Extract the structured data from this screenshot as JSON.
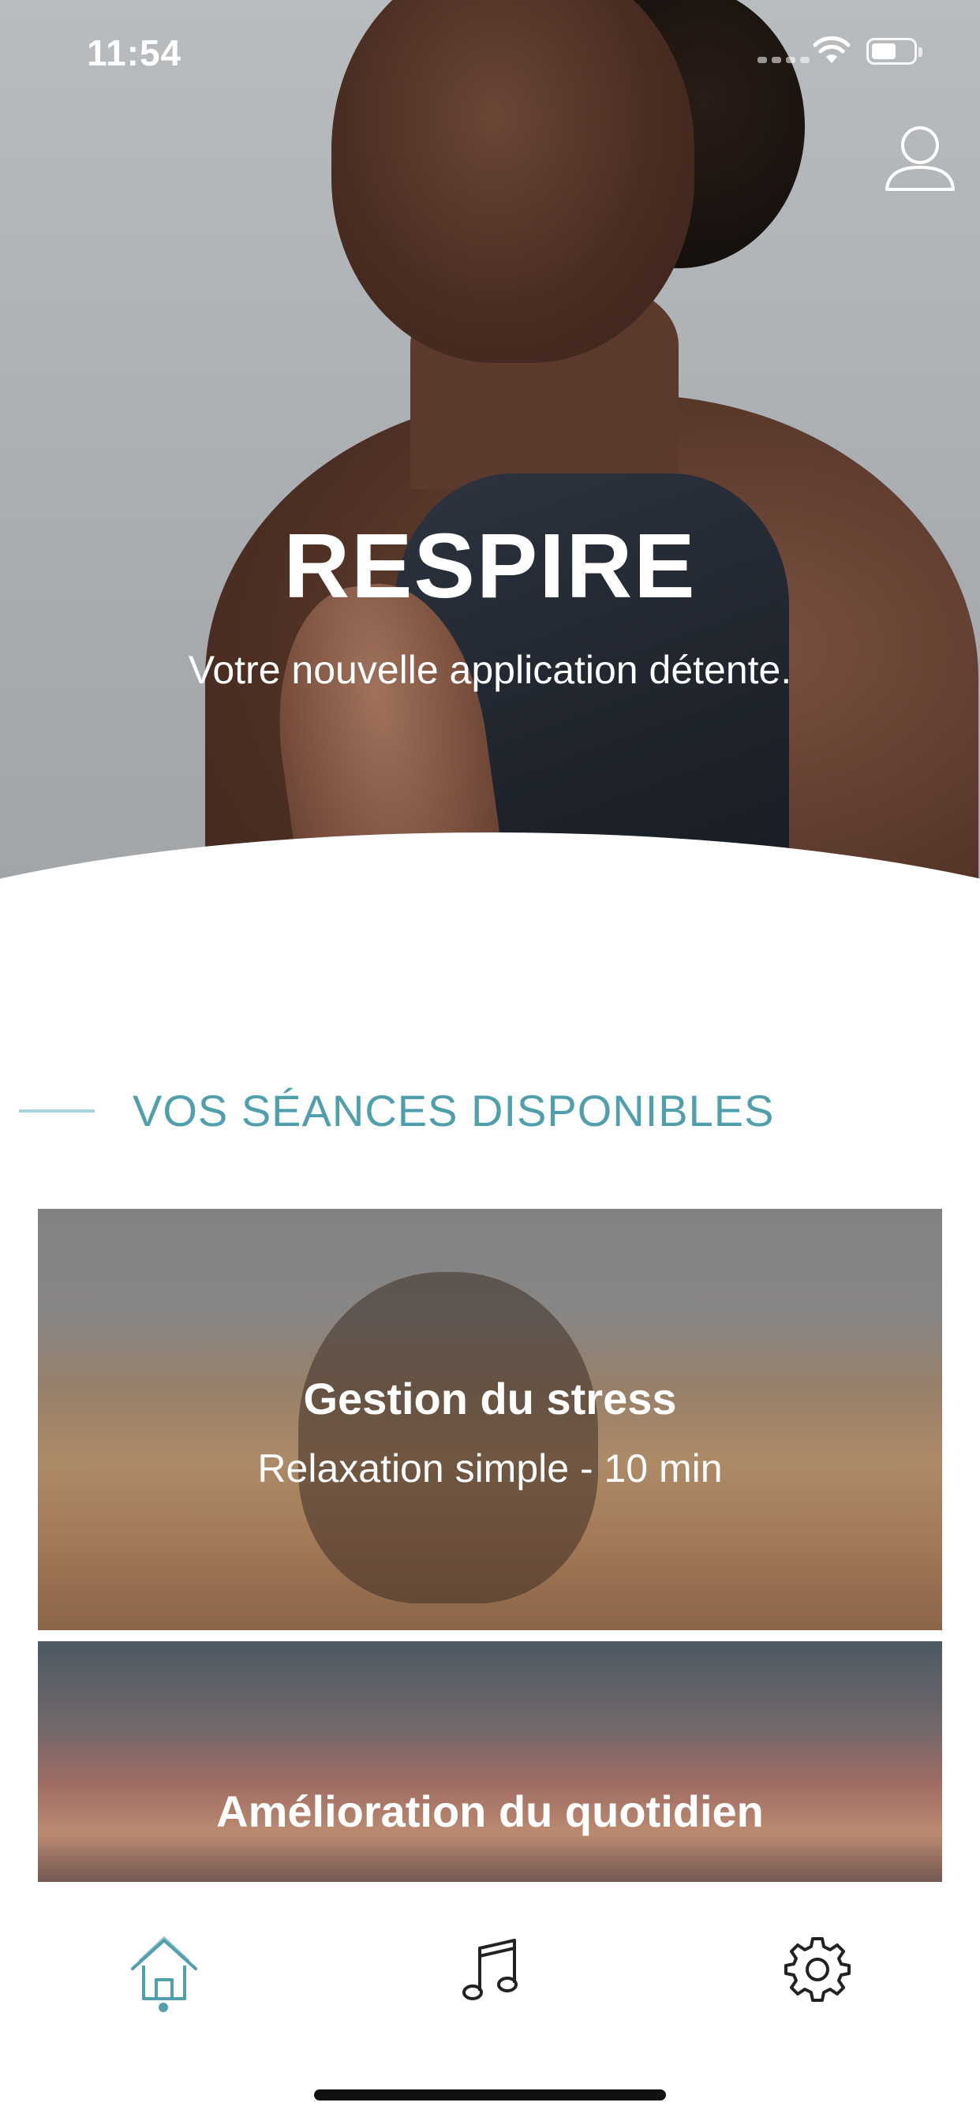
{
  "status_bar": {
    "time": "11:54"
  },
  "hero": {
    "title": "RESPIRE",
    "subtitle": "Votre nouvelle application détente.",
    "page_count": 2,
    "active_page": 1
  },
  "section": {
    "title": "VOS SÉANCES DISPONIBLES"
  },
  "sessions": [
    {
      "title": "Gestion du stress",
      "subtitle": "Relaxation simple - 10 min"
    },
    {
      "title": "Amélioration du quotidien",
      "subtitle": ""
    }
  ],
  "tab_bar": {
    "items": [
      {
        "icon": "home-icon",
        "active": true
      },
      {
        "icon": "music-note-icon",
        "active": false
      },
      {
        "icon": "gear-icon",
        "active": false
      }
    ]
  },
  "colors": {
    "accent": "#4f9fad",
    "accent_light": "#a9d3da"
  }
}
